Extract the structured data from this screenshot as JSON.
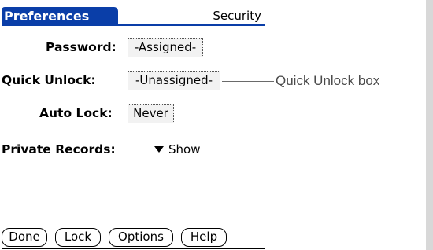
{
  "app": {
    "title": "Preferences",
    "category": "Security",
    "title_color": "#0a3ea8"
  },
  "form": {
    "password": {
      "label": "Password:",
      "value": "-Assigned-"
    },
    "quick_unlock": {
      "label": "Quick Unlock:",
      "value": "-Unassigned-"
    },
    "auto_lock": {
      "label": "Auto Lock:",
      "value": "Never"
    },
    "private_records": {
      "label": "Private Records:",
      "value": "Show",
      "icon": "dropdown-arrow-icon"
    }
  },
  "buttons": {
    "done": "Done",
    "lock": "Lock",
    "options": "Options",
    "help": "Help"
  },
  "callout": {
    "label": "Quick Unlock box"
  }
}
